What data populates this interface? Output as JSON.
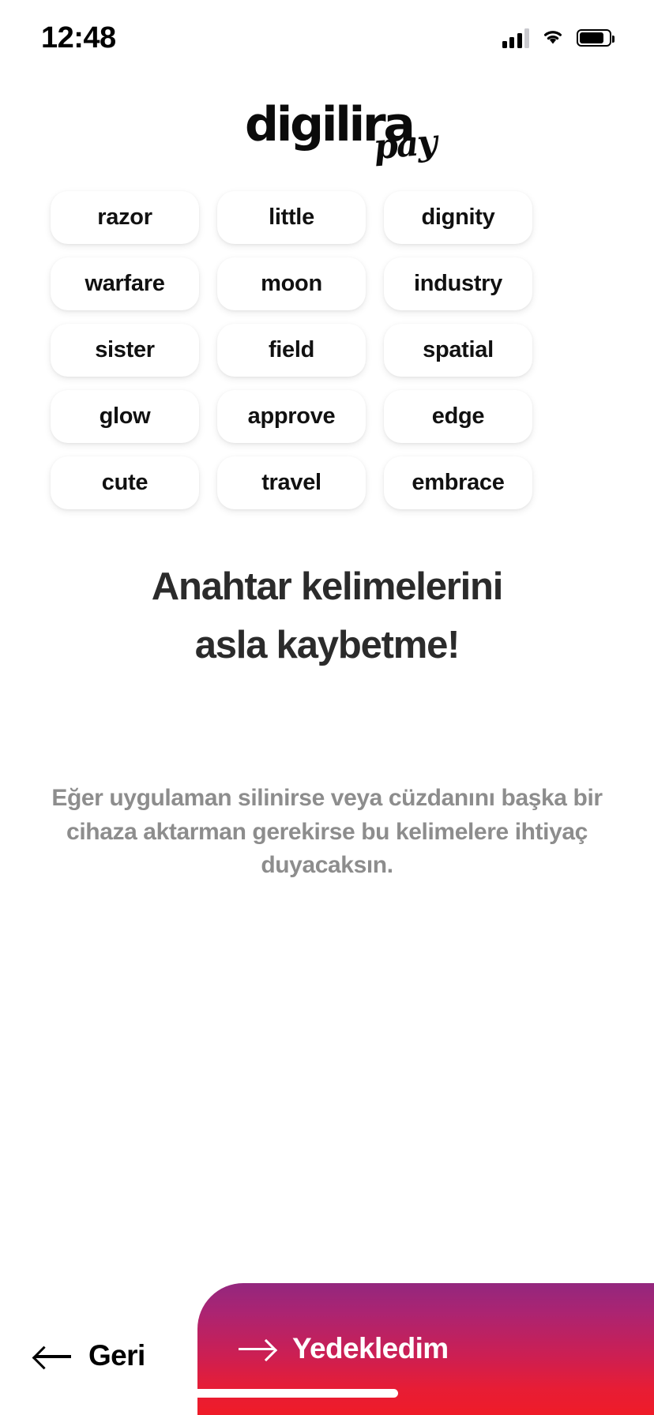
{
  "status_bar": {
    "time": "12:48",
    "icons": [
      "cellular-signal-icon",
      "wifi-icon",
      "battery-icon"
    ]
  },
  "brand": {
    "name": "digilira",
    "suffix": "pay"
  },
  "recovery_words": [
    "razor",
    "little",
    "dignity",
    "warfare",
    "moon",
    "industry",
    "sister",
    "field",
    "spatial",
    "glow",
    "approve",
    "edge",
    "cute",
    "travel",
    "embrace"
  ],
  "content": {
    "heading_line1": "Anahtar kelimelerini",
    "heading_line2": "asla kaybetme!",
    "body": "Eğer uygulaman silinirse veya cüzdanını başka bir cihaza aktarman gerekirse bu kelimelere ihtiyaç duyacaksın."
  },
  "footer": {
    "back_label": "Geri",
    "cta_label": "Yedekledim"
  },
  "colors": {
    "gradient_top": "#93277e",
    "gradient_bottom": "#ef1b28",
    "heading": "#2b2b2b",
    "body_text": "#8d8d8d",
    "card_bg": "#ffffff"
  }
}
